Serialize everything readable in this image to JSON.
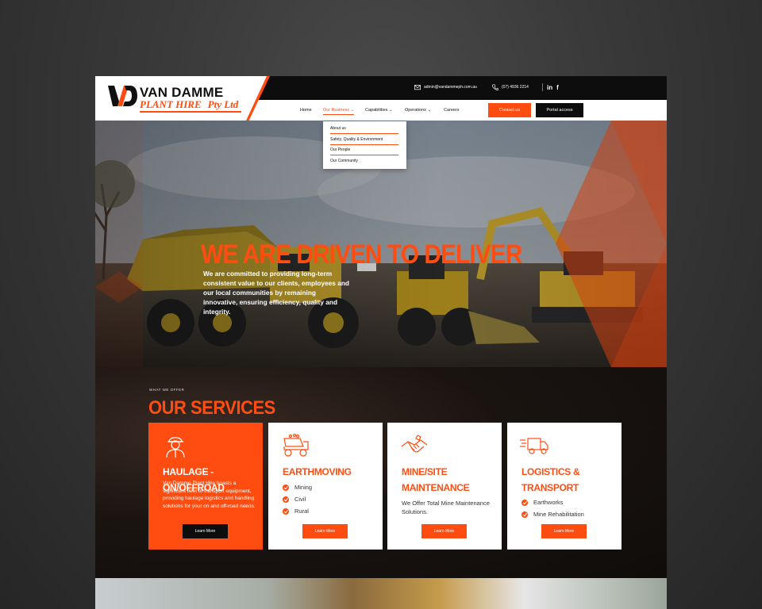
{
  "header": {
    "logo": {
      "name": "VAN DAMME",
      "sub": "PLANT HIRE",
      "pty": "Pty Ltd"
    },
    "email": "admin@vandammeph.com.au",
    "phone": "(07) 4936 2214",
    "socials": {
      "linkedin": "in",
      "facebook": "f"
    },
    "nav": [
      {
        "label": "Home"
      },
      {
        "label": "Our Business"
      },
      {
        "label": "Capabilities"
      },
      {
        "label": "Operations"
      },
      {
        "label": "Careers"
      }
    ],
    "contact_button": "Contact us",
    "portal_button": "Portal access",
    "dropdown": [
      {
        "label": "About us"
      },
      {
        "label": "Safety, Quality & Environment"
      },
      {
        "label": "Our People"
      },
      {
        "label": "Our Community"
      }
    ]
  },
  "hero": {
    "title": "WE ARE DRIVEN TO DELIVER",
    "text": "We are committed to providing long-term consistent value to our clients, employees and our local communities by remaining innovative, ensuring efficiency, quality and integrity."
  },
  "services": {
    "eyebrow": "WHAT WE OFFER",
    "title": "OUR SERVICES",
    "cards": [
      {
        "icon": "worker-icon",
        "title": "HAULAGE - ON/OFFROAD",
        "desc": "Van Damme Plant Hire boasts a significant fleet of transport equipment, providing haulage logistics and handling solutions for your on and off-road needs.",
        "button": "Learn More"
      },
      {
        "icon": "dump-truck-icon",
        "title": "EARTHMOVING",
        "items": [
          "Mining",
          "Civil",
          "Rural"
        ],
        "button": "Learn More"
      },
      {
        "icon": "handshake-icon",
        "title_lines": [
          "MINE/SITE",
          "MAINTENANCE"
        ],
        "desc": "We Offer Total Mine Maintenance Solutions.",
        "button": "Learn More"
      },
      {
        "icon": "delivery-truck-icon",
        "title_lines": [
          "LOGISTICS &",
          "TRANSPORT"
        ],
        "items": [
          "Earthworks",
          "Mine Rehabilitation"
        ],
        "button": "Learn More"
      }
    ]
  },
  "colors": {
    "accent": "#ff4d12",
    "dark": "#0d0d0d"
  }
}
